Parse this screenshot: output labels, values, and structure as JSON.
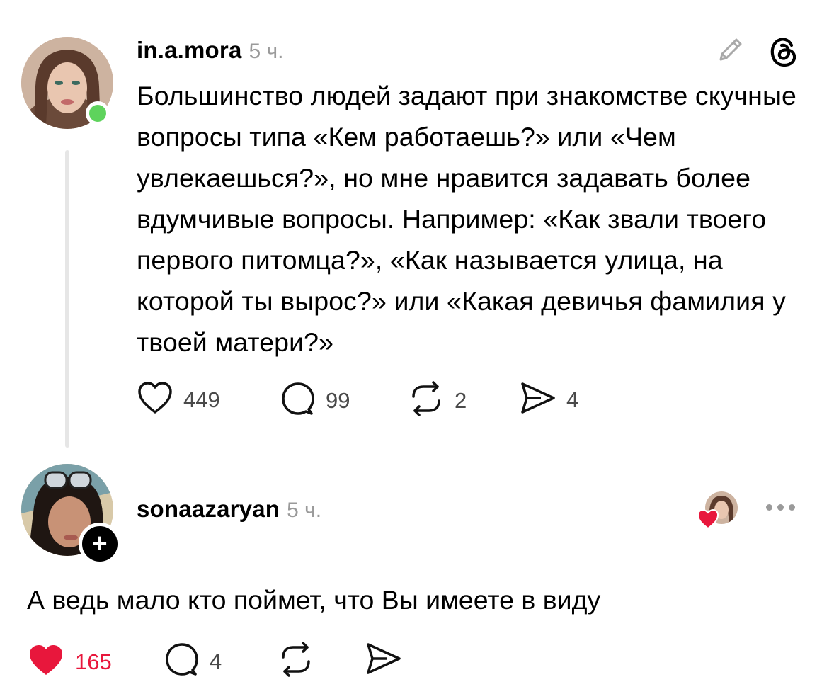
{
  "post": {
    "username": "in.a.mora",
    "time": "5 ч.",
    "text": "Большинство людей задают при знакомстве скучные вопросы типа «Кем работаешь?» или «Чем увлекаешься?», но мне нравится задавать более вдумчивые вопросы. Например: «Как звали твоего первого питомца?», «Как называется улица, на которой ты вырос?» или «Какая девичья фамилия у твоей матери?»",
    "likes": "449",
    "comments": "99",
    "reposts": "2",
    "shares": "4",
    "online": true
  },
  "reply": {
    "username": "sonaazaryan",
    "time": "5 ч.",
    "text": "А ведь мало кто поймет, что Вы имеете в виду",
    "likes": "165",
    "comments": "4",
    "liked_by_author": true
  },
  "icons": {
    "edit": "pencil-icon",
    "threads": "threads-logo-icon",
    "like": "heart-icon",
    "comment": "comment-bubble-icon",
    "repost": "repost-icon",
    "share": "send-icon",
    "more": "more-dots-icon"
  },
  "colors": {
    "like_active": "#e8173c",
    "online": "#5ed35c",
    "muted": "#9a9a9a"
  }
}
